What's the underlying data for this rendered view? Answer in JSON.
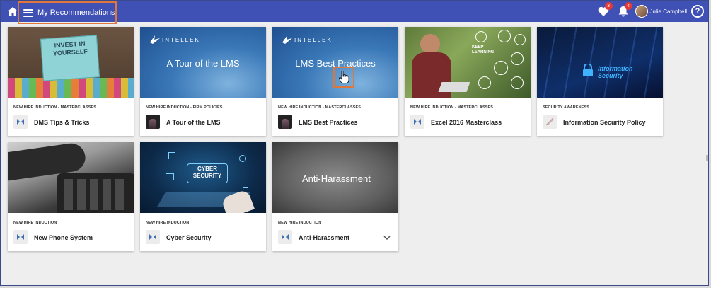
{
  "header": {
    "title": "My Recommendations",
    "favorites_count": "3",
    "notifications_count": "4",
    "user_name": "Julie Campbell",
    "help_glyph": "?"
  },
  "colors": {
    "topbar": "#3f51b5",
    "highlight": "#e0763a",
    "badge": "#e53935"
  },
  "cards": [
    {
      "category": "NEW HIRE INDUCTION - MASTERCLASSES",
      "title": "DMS Tips & Tricks",
      "thumb_text": "INVEST IN YOURSELF",
      "icon": "course-icon"
    },
    {
      "category": "NEW HIRE INDUCTION - FIRM POLICIES",
      "title": "A Tour of the LMS",
      "thumb_text": "A Tour of the LMS",
      "brand": "INTELLEK",
      "icon": "video-icon"
    },
    {
      "category": "NEW HIRE INDUCTION - MASTERCLASSES",
      "title": "LMS Best Practices",
      "thumb_text": "LMS Best Practices",
      "brand": "INTELLEK",
      "icon": "video-icon"
    },
    {
      "category": "NEW HIRE INDUCTION - MASTERCLASSES",
      "title": "Excel 2016 Masterclass",
      "thumb_text": "KEEP LEARNING",
      "icon": "course-icon"
    },
    {
      "category": "SECURITY AWARENESS",
      "title": "Information Security Policy",
      "thumb_text": "Information Security",
      "icon": "document-icon"
    },
    {
      "category": "NEW HIRE INDUCTION",
      "title": "New Phone System",
      "icon": "course-icon"
    },
    {
      "category": "NEW HIRE INDUCTION",
      "title": "Cyber Security",
      "thumb_text": "CYBER SECURITY",
      "icon": "course-icon"
    },
    {
      "category": "NEW HIRE INDUCTION",
      "title": "Anti-Harassment",
      "thumb_text": "Anti-Harassment",
      "icon": "course-icon"
    }
  ]
}
